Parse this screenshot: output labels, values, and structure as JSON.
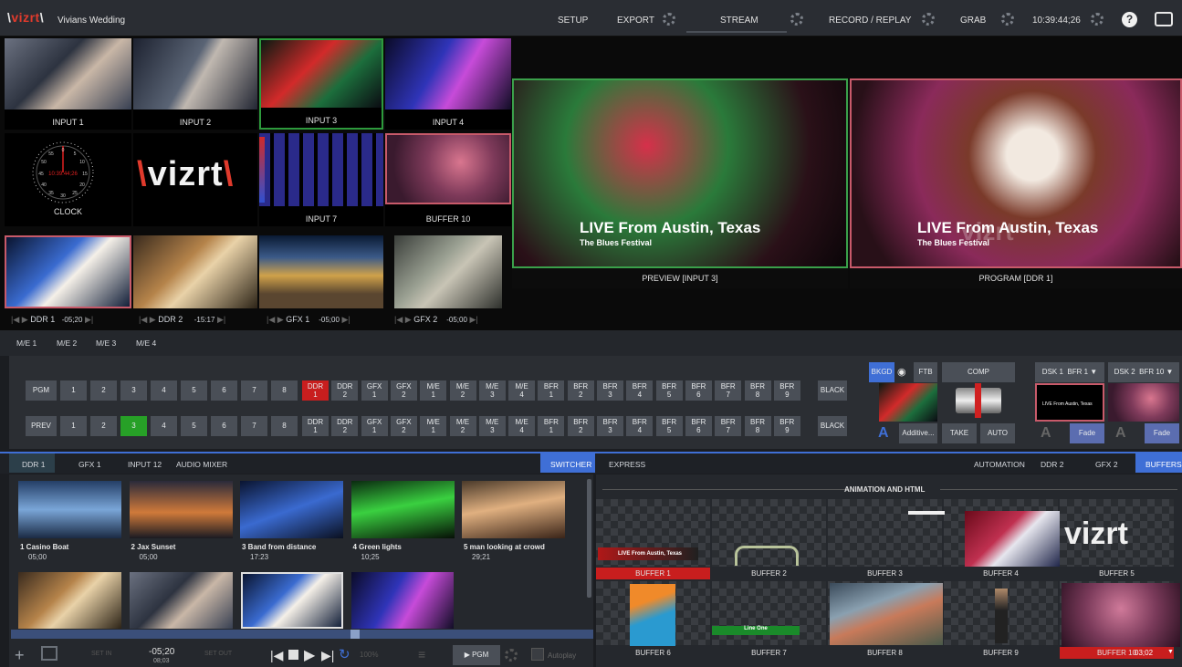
{
  "app": {
    "logo": "vizrt",
    "session_title": "Vivians Wedding"
  },
  "topbar": {
    "setup": "SETUP",
    "export": "EXPORT",
    "stream": "STREAM",
    "record_replay": "RECORD / REPLAY",
    "grab": "GRAB",
    "timecode": "10:39:44;26",
    "help_icon": "help-icon",
    "notes_icon": "notes-icon"
  },
  "multiview": {
    "row1": [
      "INPUT 1",
      "INPUT 2",
      "INPUT 3",
      "INPUT 4"
    ],
    "clock_label": "CLOCK",
    "clock_time": "10:39:44;26",
    "clock_face": [
      "0",
      "5",
      "55",
      "10",
      "50",
      "45",
      "15",
      "40",
      "20",
      "35",
      "30",
      "25"
    ],
    "vizrt_tile_logo": "vizrt",
    "input7": "INPUT 7",
    "buffer10": "BUFFER 10",
    "transports": [
      {
        "name": "DDR 1",
        "time": "-05;20"
      },
      {
        "name": "DDR 2",
        "time": "-15:17"
      },
      {
        "name": "GFX 1",
        "time": "-05;00"
      },
      {
        "name": "GFX 2",
        "time": "-05;00"
      }
    ]
  },
  "preview": {
    "label": "PREVIEW [INPUT 3]",
    "lower_third_title": "LIVE From Austin, Texas",
    "lower_third_sub": "The Blues Festival"
  },
  "program": {
    "label": "PROGRAM [DDR 1]",
    "lower_third_title": "LIVE From Austin, Texas",
    "lower_third_sub": "The Blues Festival",
    "logo_overlay": "vizrt"
  },
  "me_tabs": [
    "M/E 1",
    "M/E 2",
    "M/E 3",
    "M/E 4"
  ],
  "switcher": {
    "pgm_label": "PGM",
    "prev_label": "PREV",
    "numbers": [
      "1",
      "2",
      "3",
      "4",
      "5",
      "6",
      "7",
      "8"
    ],
    "pgm_sources": [
      [
        "DDR",
        "1"
      ],
      [
        "DDR",
        "2"
      ],
      [
        "GFX",
        "1"
      ],
      [
        "GFX",
        "2"
      ],
      [
        "M/E",
        "1"
      ],
      [
        "M/E",
        "2"
      ],
      [
        "M/E",
        "3"
      ],
      [
        "M/E",
        "4"
      ],
      [
        "BFR",
        "1"
      ],
      [
        "BFR",
        "2"
      ],
      [
        "BFR",
        "3"
      ],
      [
        "BFR",
        "4"
      ],
      [
        "BFR",
        "5"
      ],
      [
        "BFR",
        "6"
      ],
      [
        "BFR",
        "7"
      ],
      [
        "BFR",
        "8"
      ],
      [
        "BFR",
        "9"
      ]
    ],
    "prev_sources": [
      [
        "DDR",
        "1"
      ],
      [
        "DDR",
        "2"
      ],
      [
        "GFX",
        "1"
      ],
      [
        "GFX",
        "2"
      ],
      [
        "M/E",
        "1"
      ],
      [
        "M/E",
        "2"
      ],
      [
        "M/E",
        "3"
      ],
      [
        "M/E",
        "4"
      ],
      [
        "BFR",
        "1"
      ],
      [
        "BFR",
        "2"
      ],
      [
        "BFR",
        "3"
      ],
      [
        "BFR",
        "4"
      ],
      [
        "BFR",
        "5"
      ],
      [
        "BFR",
        "6"
      ],
      [
        "BFR",
        "7"
      ],
      [
        "BFR",
        "8"
      ],
      [
        "BFR",
        "9"
      ]
    ],
    "black": "BLACK",
    "pgm_active": "DDR 1",
    "prev_active": "3",
    "bkgd": "BKGD",
    "ftb": "FTB",
    "comp": "COMP",
    "additive": "Additive...",
    "take": "TAKE",
    "auto": "AUTO",
    "dsk1": "DSK 1",
    "dsk1_src": "BFR 1",
    "dsk2": "DSK 2",
    "dsk2_src": "BFR 10",
    "fade": "Fade",
    "dsk_letter": "A",
    "dsk1_thumb_title": "LIVE From Austin, Texas",
    "colors": {
      "active_red": "#c81e1e",
      "active_green": "#27a027",
      "accent_blue": "#3f6fd6"
    }
  },
  "lower_tabs_left": [
    "DDR 1",
    "GFX 1",
    "INPUT 12",
    "AUDIO MIXER"
  ],
  "lower_tabs_center": [
    "SWITCHER",
    "EXPRESS"
  ],
  "lower_tabs_right": [
    "AUTOMATION",
    "DDR 2",
    "GFX 2",
    "BUFFERS"
  ],
  "ddr_playlist": [
    {
      "title": "1 Casino Boat",
      "duration": "05;00"
    },
    {
      "title": "2 Jax Sunset",
      "duration": "05;00"
    },
    {
      "title": "3 Band from distance",
      "duration": "17:23"
    },
    {
      "title": "4 Green lights",
      "duration": "10;25"
    },
    {
      "title": "5 man looking at crowd",
      "duration": "29;21"
    }
  ],
  "ddr_controls": {
    "remaining": "-05;20",
    "elapsed": "08;03",
    "speed": "100%",
    "set_in": "SET IN",
    "set_out": "SET OUT",
    "pgm_btn": "▶ PGM",
    "autoplay": "Autoplay"
  },
  "buffers": {
    "header": "ANIMATION AND HTML",
    "items": [
      "BUFFER 1",
      "BUFFER 2",
      "BUFFER 3",
      "BUFFER 4",
      "BUFFER 5",
      "BUFFER 6",
      "BUFFER 7",
      "BUFFER 8",
      "BUFFER 9",
      "BUFFER 10"
    ],
    "buffer10_time": "03;02",
    "buffer1_text": "LIVE From Austin, Texas",
    "buffer7_text": "Line One",
    "buffer5_logo": "vizrt"
  }
}
